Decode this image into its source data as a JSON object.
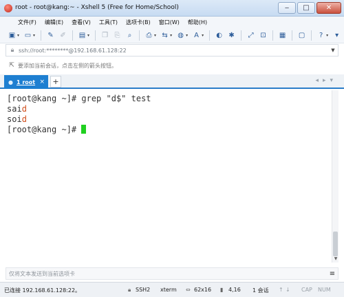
{
  "window": {
    "title": "root - root@kang:~ - Xshell 5 (Free for Home/School)",
    "minimize": "‒",
    "maximize": "□",
    "close": "✕"
  },
  "menu": [
    "文件(F)",
    "编辑(E)",
    "查看(V)",
    "工具(T)",
    "选项卡(B)",
    "窗口(W)",
    "帮助(H)"
  ],
  "toolbar": {
    "icons": [
      "new-session-icon",
      "open-folder-icon",
      "connect-icon",
      "disconnect-icon",
      "properties-icon",
      "copy-icon",
      "paste-icon",
      "find-icon",
      "print-icon",
      "transfer-icon",
      "globe-icon",
      "font-icon",
      "xftp-icon",
      "scripts-icon",
      "fullscreen-icon",
      "lock-screen-icon",
      "keyboard-icon",
      "chat-icon",
      "help-icon",
      "options-icon"
    ]
  },
  "address": {
    "value": "ssh://root:********@192.168.61.128:22"
  },
  "hint": {
    "text": "要添加当前会话，点击左侧的箭头按钮。"
  },
  "tabs": [
    {
      "label": "1 root",
      "active": true
    }
  ],
  "tab_add": "+",
  "terminal": {
    "lines": [
      {
        "text": "[root@kang ~]# grep \"d$\" test"
      },
      {
        "prefix": "sai",
        "match": "d"
      },
      {
        "prefix": "soi",
        "match": "d"
      },
      {
        "text": "[root@kang ~]# "
      }
    ],
    "match_color": "#d04e1c",
    "cursor_color": "#20d020"
  },
  "send_bar": {
    "placeholder": "仅将文本发送到当前选项卡"
  },
  "status": {
    "connection": "已连接 192.168.61.128:22。",
    "protocol": "SSH2",
    "terminal_type": "xterm",
    "size": "62x16",
    "cursor_pos": "4,16",
    "sessions": "1 会话",
    "caps": "CAP",
    "num": "NUM"
  }
}
